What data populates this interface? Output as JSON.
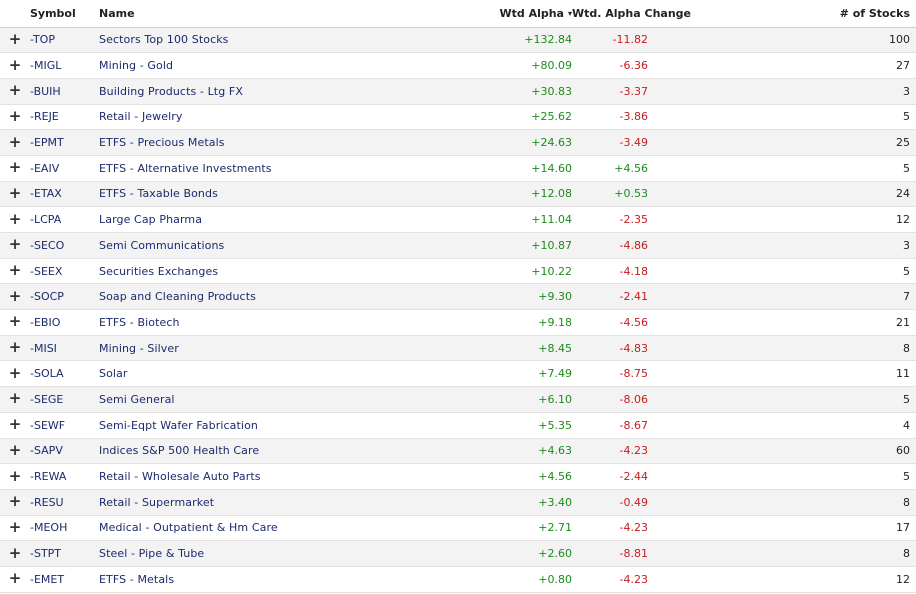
{
  "colors": {
    "positive": "#1f8a1f",
    "negative": "#c41e1e",
    "link": "#1b2a6b",
    "row_alt": "#f3f3f3"
  },
  "header": {
    "symbol": "Symbol",
    "name": "Name",
    "wtd_alpha": "Wtd Alpha",
    "wtd_alpha_change": "Wtd. Alpha Change",
    "num_stocks": "# of Stocks",
    "sort_icon": "▾"
  },
  "rows": [
    {
      "symbol": "-TOP",
      "name": "Sectors Top 100 Stocks",
      "alpha": "+132.84",
      "change": "-11.82",
      "count": "100"
    },
    {
      "symbol": "-MIGL",
      "name": "Mining - Gold",
      "alpha": "+80.09",
      "change": "-6.36",
      "count": "27"
    },
    {
      "symbol": "-BUIH",
      "name": "Building Products - Ltg FX",
      "alpha": "+30.83",
      "change": "-3.37",
      "count": "3"
    },
    {
      "symbol": "-REJE",
      "name": "Retail - Jewelry",
      "alpha": "+25.62",
      "change": "-3.86",
      "count": "5"
    },
    {
      "symbol": "-EPMT",
      "name": "ETFS - Precious Metals",
      "alpha": "+24.63",
      "change": "-3.49",
      "count": "25"
    },
    {
      "symbol": "-EAIV",
      "name": "ETFS - Alternative Investments",
      "alpha": "+14.60",
      "change": "+4.56",
      "count": "5"
    },
    {
      "symbol": "-ETAX",
      "name": "ETFS - Taxable Bonds",
      "alpha": "+12.08",
      "change": "+0.53",
      "count": "24"
    },
    {
      "symbol": "-LCPA",
      "name": "Large Cap Pharma",
      "alpha": "+11.04",
      "change": "-2.35",
      "count": "12"
    },
    {
      "symbol": "-SECO",
      "name": "Semi Communications",
      "alpha": "+10.87",
      "change": "-4.86",
      "count": "3"
    },
    {
      "symbol": "-SEEX",
      "name": "Securities Exchanges",
      "alpha": "+10.22",
      "change": "-4.18",
      "count": "5"
    },
    {
      "symbol": "-SOCP",
      "name": "Soap and Cleaning Products",
      "alpha": "+9.30",
      "change": "-2.41",
      "count": "7"
    },
    {
      "symbol": "-EBIO",
      "name": "ETFS - Biotech",
      "alpha": "+9.18",
      "change": "-4.56",
      "count": "21"
    },
    {
      "symbol": "-MISI",
      "name": "Mining - Silver",
      "alpha": "+8.45",
      "change": "-4.83",
      "count": "8"
    },
    {
      "symbol": "-SOLA",
      "name": "Solar",
      "alpha": "+7.49",
      "change": "-8.75",
      "count": "11"
    },
    {
      "symbol": "-SEGE",
      "name": "Semi General",
      "alpha": "+6.10",
      "change": "-8.06",
      "count": "5"
    },
    {
      "symbol": "-SEWF",
      "name": "Semi-Eqpt Wafer Fabrication",
      "alpha": "+5.35",
      "change": "-8.67",
      "count": "4"
    },
    {
      "symbol": "-SAPV",
      "name": "Indices S&P 500 Health Care",
      "alpha": "+4.63",
      "change": "-4.23",
      "count": "60"
    },
    {
      "symbol": "-REWA",
      "name": "Retail - Wholesale Auto Parts",
      "alpha": "+4.56",
      "change": "-2.44",
      "count": "5"
    },
    {
      "symbol": "-RESU",
      "name": "Retail - Supermarket",
      "alpha": "+3.40",
      "change": "-0.49",
      "count": "8"
    },
    {
      "symbol": "-MEOH",
      "name": "Medical - Outpatient & Hm Care",
      "alpha": "+2.71",
      "change": "-4.23",
      "count": "17"
    },
    {
      "symbol": "-STPT",
      "name": "Steel - Pipe & Tube",
      "alpha": "+2.60",
      "change": "-8.81",
      "count": "8"
    },
    {
      "symbol": "-EMET",
      "name": "ETFS - Metals",
      "alpha": "+0.80",
      "change": "-4.23",
      "count": "12"
    }
  ],
  "expand_icon": "+"
}
